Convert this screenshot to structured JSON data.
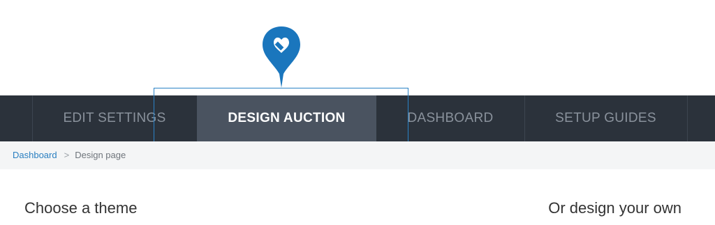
{
  "nav": {
    "items": [
      {
        "label": "EDIT SETTINGS",
        "active": false
      },
      {
        "label": "DESIGN AUCTION",
        "active": true
      },
      {
        "label": "DASHBOARD",
        "active": false
      },
      {
        "label": "SETUP GUIDES",
        "active": false
      }
    ]
  },
  "breadcrumb": {
    "link_label": "Dashboard",
    "separator": ">",
    "current": "Design page"
  },
  "main": {
    "left_heading": "Choose a theme",
    "right_heading": "Or design your own"
  },
  "callout": {
    "icon": "paint-brush-heart-icon",
    "color": "#1a76bd"
  },
  "colors": {
    "navbar_bg": "#2b323b",
    "active_tab_bg": "#4a5360",
    "accent": "#2a82c6"
  }
}
